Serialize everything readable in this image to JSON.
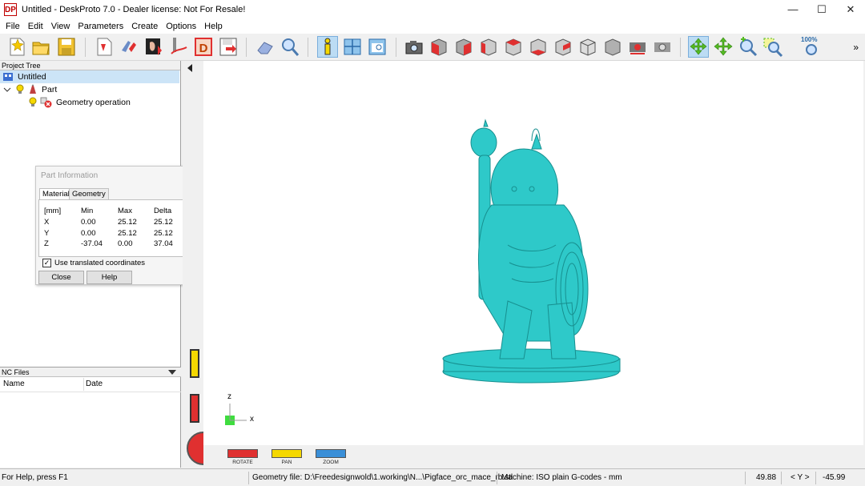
{
  "window": {
    "app_icon": "DP",
    "title": "Untitled - DeskProto 7.0 - Dealer license: Not For Resale!",
    "minimize": "—",
    "maximize": "☐",
    "close": "✕"
  },
  "menu": [
    "File",
    "Edit",
    "View",
    "Parameters",
    "Create",
    "Options",
    "Help"
  ],
  "toolbar": {
    "zoom_label": "100%",
    "overflow": "»",
    "colors": {
      "red": "#e03030",
      "grey": "#a8a8a8",
      "yellow": "#f5d800",
      "blue": "#3a8fd8",
      "green": "#55bb22"
    }
  },
  "project_tree": {
    "header": "Project Tree",
    "items": [
      {
        "label": "Untitled"
      },
      {
        "label": "Part"
      },
      {
        "label": "Geometry operation"
      }
    ]
  },
  "nc_files": {
    "header": "NC Files",
    "columns": [
      "Name",
      "Date"
    ]
  },
  "part_info": {
    "title": "Part Information",
    "tabs": [
      "Material",
      "Geometry"
    ],
    "grid_header": [
      "[mm]",
      "Min",
      "Max",
      "Delta"
    ],
    "rows": [
      [
        "X",
        "0.00",
        "25.12",
        "25.12"
      ],
      [
        "Y",
        "0.00",
        "25.12",
        "25.12"
      ],
      [
        "Z",
        "-37.04",
        "0.00",
        "37.04"
      ]
    ],
    "checkbox_label": "Use translated coordinates",
    "checked": true,
    "close_label": "Close",
    "help_label": "Help"
  },
  "viewport": {
    "model_color": "#2ec9c9",
    "axis_z": "z",
    "axis_x": "x"
  },
  "bottom_controls": {
    "rotate": "ROTATE",
    "pan": "PAN",
    "zoom": "ZOOM"
  },
  "status": {
    "help": "For Help, press F1",
    "geometry_file": "Geometry file: D:\\Freedesignwold\\1.working\\N...\\Pigface_orc_mace_rb.stl",
    "machine": "Machine: ISO plain G-codes - mm",
    "coord_a": "49.88",
    "coord_label": "< Y >",
    "coord_b": "-45.99"
  }
}
